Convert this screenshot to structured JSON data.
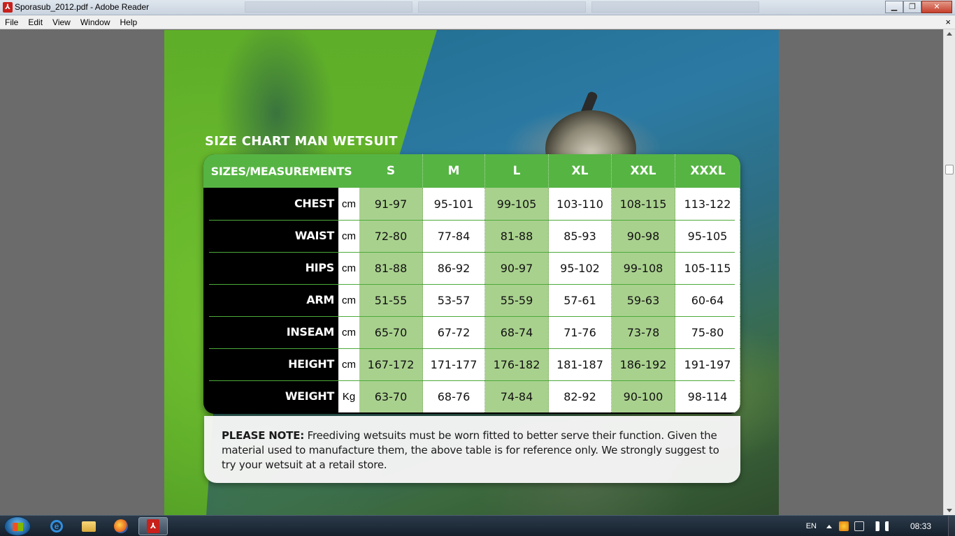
{
  "window": {
    "title": "Sporasub_2012.pdf - Adobe Reader",
    "minimize": "▁",
    "maximize": "❐",
    "close": "✕"
  },
  "menu": {
    "items": [
      "File",
      "Edit",
      "View",
      "Window",
      "Help"
    ],
    "doc_close": "×"
  },
  "document": {
    "chart_title": "SIZE CHART MAN WETSUIT",
    "header_label": "SIZES/MEASUREMENTS",
    "sizes": [
      "S",
      "M",
      "L",
      "XL",
      "XXL",
      "XXXL"
    ],
    "rows": [
      {
        "name": "CHEST",
        "unit": "cm",
        "values": [
          "91-97",
          "95-101",
          "99-105",
          "103-110",
          "108-115",
          "113-122"
        ]
      },
      {
        "name": "WAIST",
        "unit": "cm",
        "values": [
          "72-80",
          "77-84",
          "81-88",
          "85-93",
          "90-98",
          "95-105"
        ]
      },
      {
        "name": "HIPS",
        "unit": "cm",
        "values": [
          "81-88",
          "86-92",
          "90-97",
          "95-102",
          "99-108",
          "105-115"
        ]
      },
      {
        "name": "ARM",
        "unit": "cm",
        "values": [
          "51-55",
          "53-57",
          "55-59",
          "57-61",
          "59-63",
          "60-64"
        ]
      },
      {
        "name": "INSEAM",
        "unit": "cm",
        "values": [
          "65-70",
          "67-72",
          "68-74",
          "71-76",
          "73-78",
          "75-80"
        ]
      },
      {
        "name": "HEIGHT",
        "unit": "cm",
        "values": [
          "167-172",
          "171-177",
          "176-182",
          "181-187",
          "186-192",
          "191-197"
        ]
      },
      {
        "name": "WEIGHT",
        "unit": "Kg",
        "values": [
          "63-70",
          "68-76",
          "74-84",
          "82-92",
          "90-100",
          "98-114"
        ]
      }
    ],
    "note_label": "PLEASE NOTE:",
    "note_text": " Freediving wetsuits must be worn fitted to better serve their function. Given the material used to manufacture them, the above table is for reference only. We strongly suggest to try your wetsuit at a retail store."
  },
  "taskbar": {
    "apps": [
      {
        "name": "internet-explorer",
        "icon": "ie-icon"
      },
      {
        "name": "file-explorer",
        "icon": "folder-icon"
      },
      {
        "name": "firefox",
        "icon": "firefox-icon"
      },
      {
        "name": "adobe-reader",
        "icon": "pdf-icon",
        "active": true
      }
    ],
    "language": "EN",
    "clock": "08:33"
  },
  "colors": {
    "header_green": "#56b443",
    "cell_green": "#a9d18e",
    "measure_black": "#000000"
  }
}
